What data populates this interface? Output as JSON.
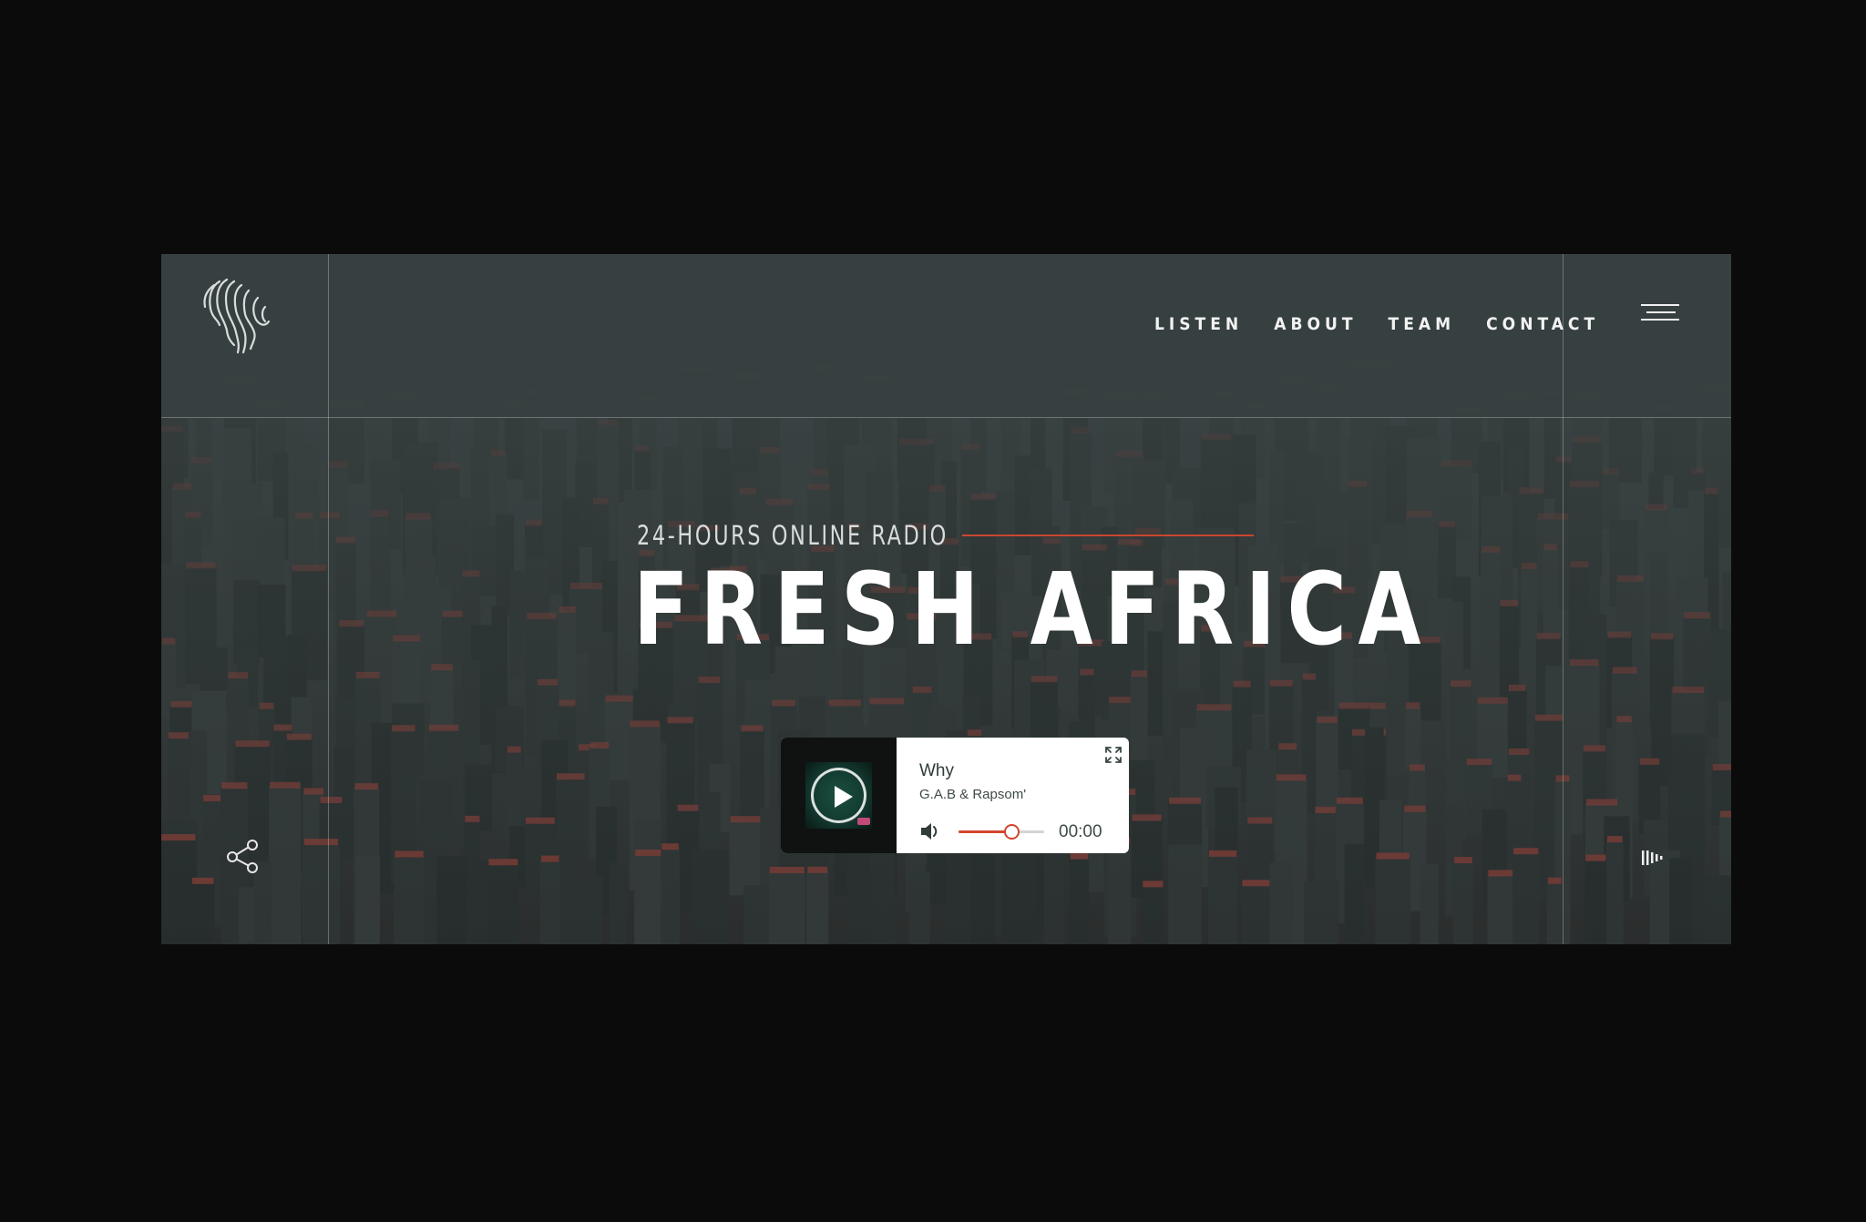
{
  "nav": {
    "items": [
      {
        "label": "LISTEN"
      },
      {
        "label": "ABOUT"
      },
      {
        "label": "TEAM"
      },
      {
        "label": "CONTACT"
      }
    ]
  },
  "hero": {
    "subtitle": "24-HOURS ONLINE RADIO",
    "title": "FRESH AFRICA"
  },
  "player": {
    "track_title": "Why",
    "artist": "G.A.B & Rapsom'",
    "time": "00:00",
    "volume": 0.62
  },
  "icons": {
    "logo": "africa-fingerprint-logo",
    "menu": "hamburger-icon",
    "share": "share-icon",
    "play": "play-icon",
    "expand": "expand-icon",
    "volume": "speaker-icon",
    "equalizer": "equalizer-icon"
  },
  "colors": {
    "accent": "#d2472e",
    "panel": "#374040",
    "page_bg": "#0b0b0c"
  }
}
